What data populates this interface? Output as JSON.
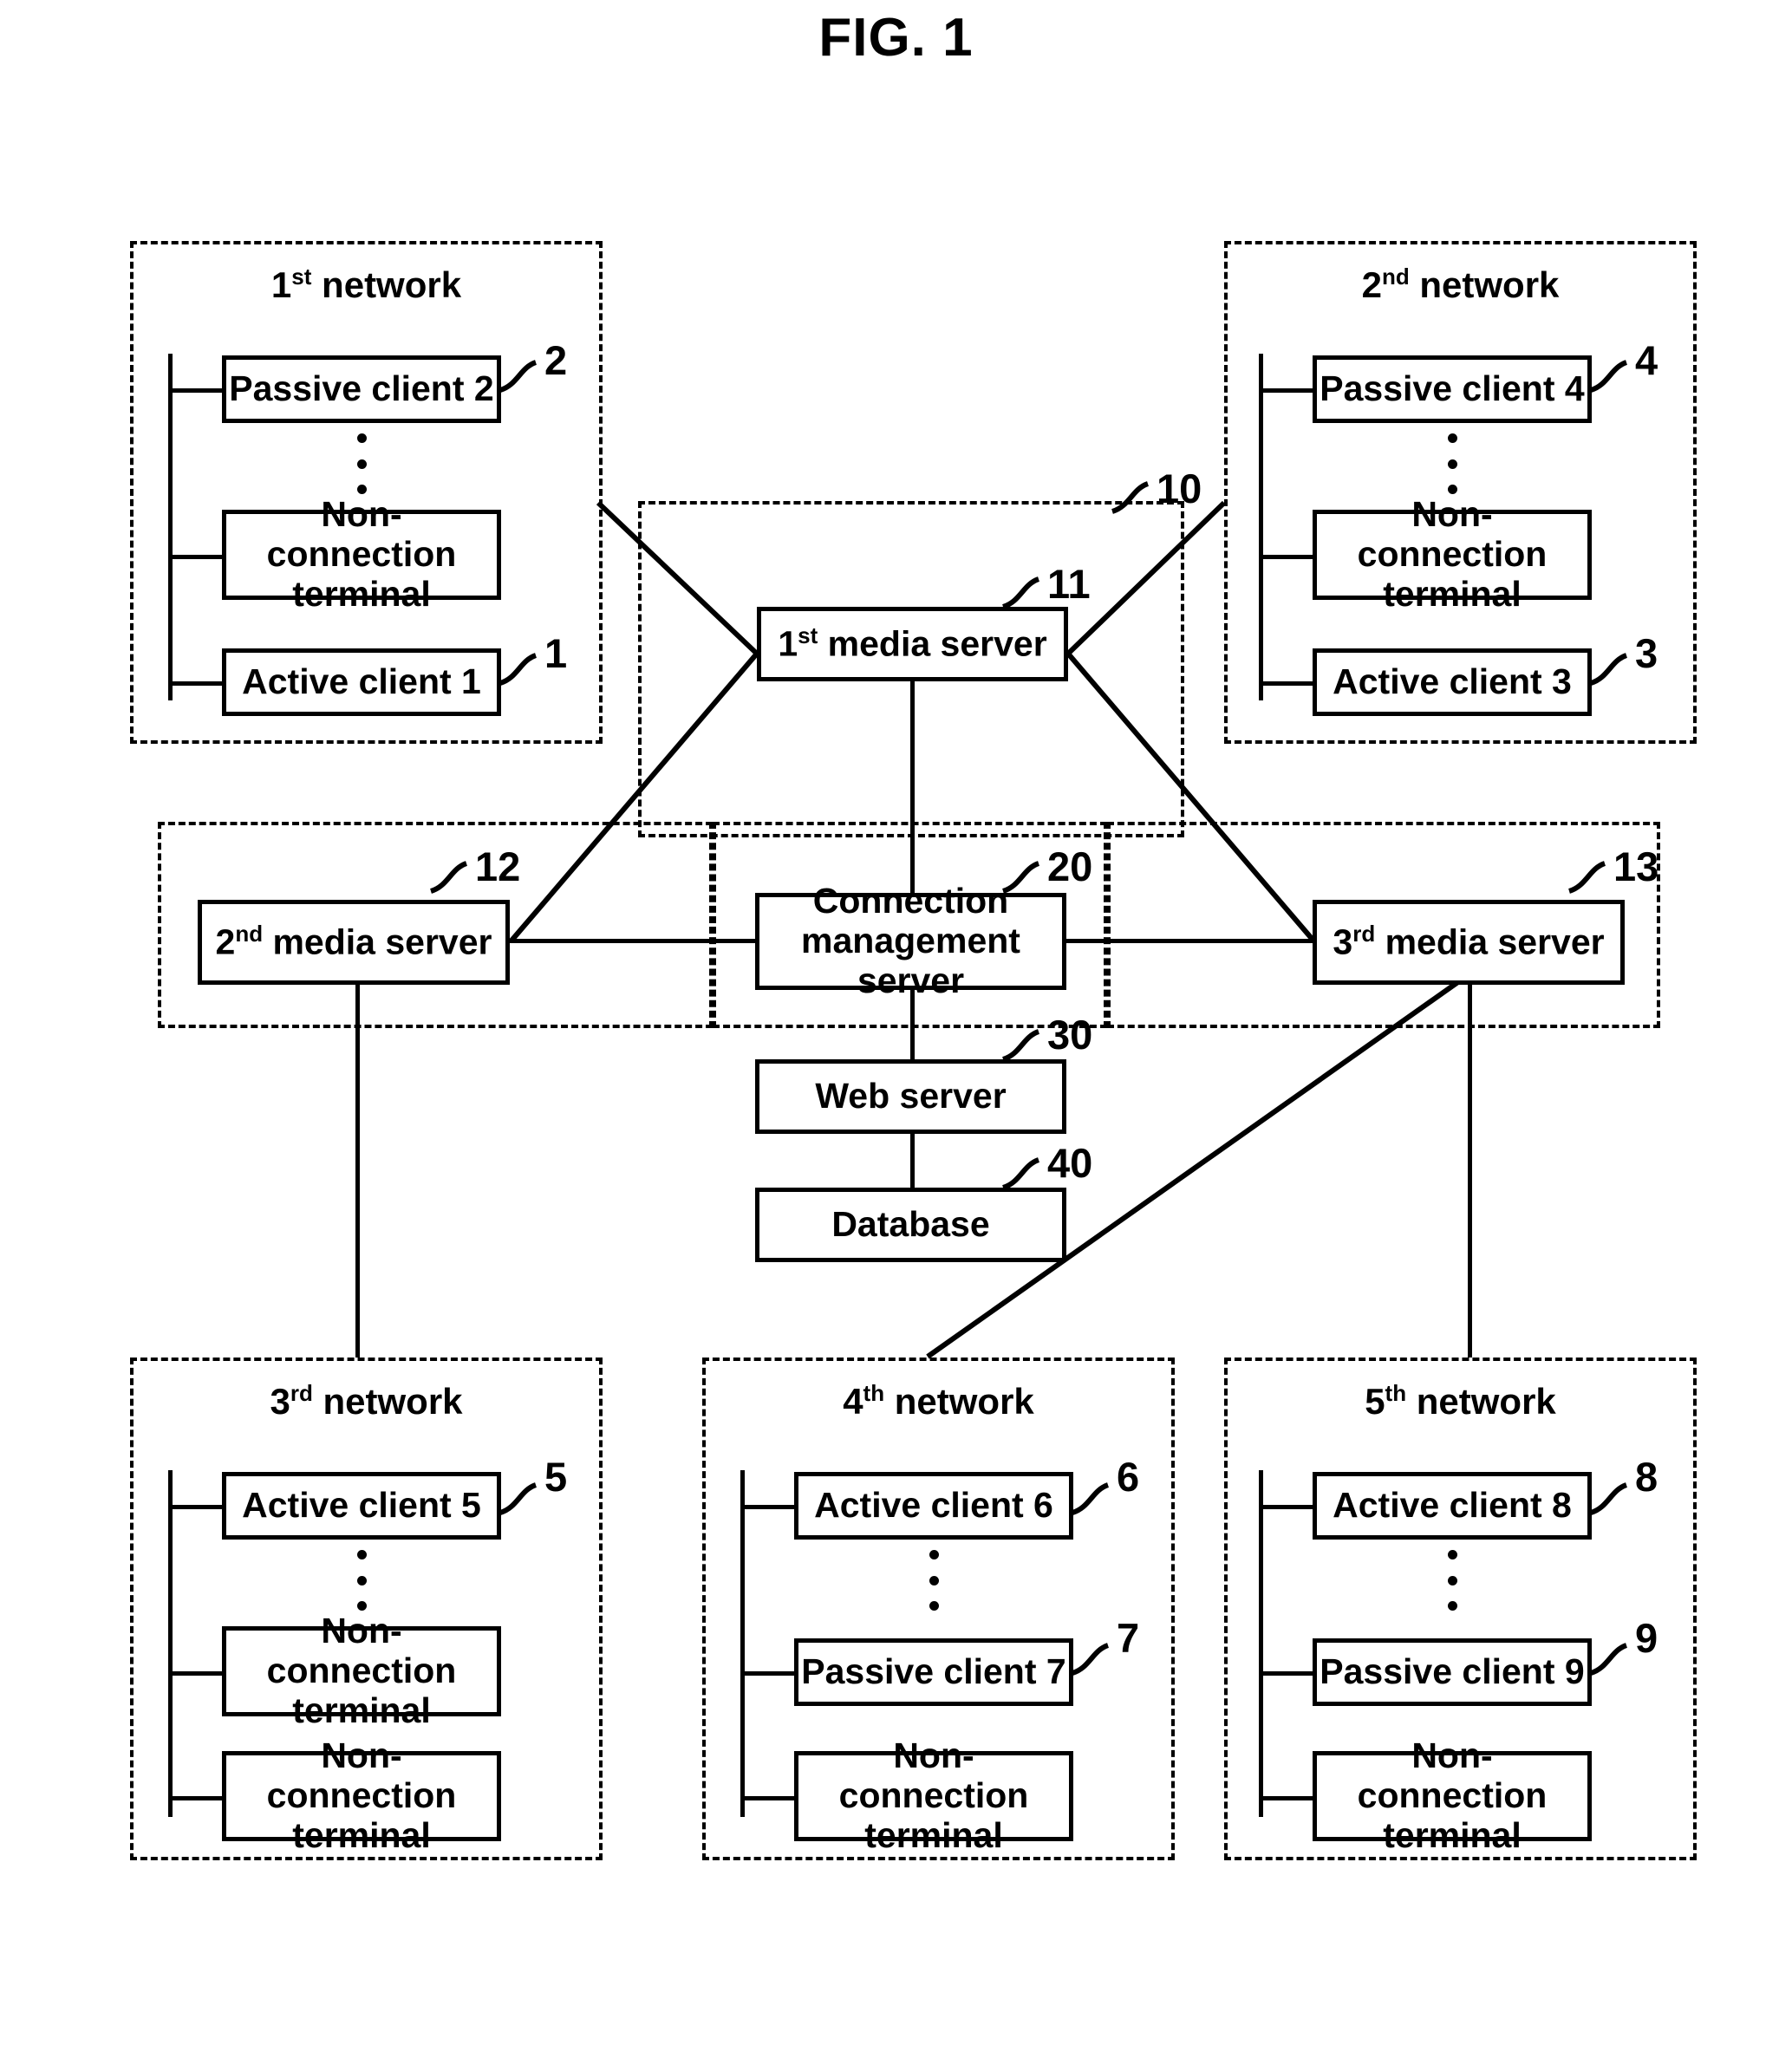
{
  "figure": {
    "title": "FIG. 1"
  },
  "networks": {
    "n1": {
      "label_num": "1",
      "label_sup": "st",
      "label_tail": " network",
      "nodes": [
        {
          "text": "Passive client 2",
          "ref": "2"
        },
        {
          "text": "Non-connection terminal",
          "ref": ""
        },
        {
          "text": "Active client 1",
          "ref": "1"
        }
      ]
    },
    "n2": {
      "label_num": "2",
      "label_sup": "nd",
      "label_tail": " network",
      "nodes": [
        {
          "text": "Passive client 4",
          "ref": "4"
        },
        {
          "text": "Non-connection terminal",
          "ref": ""
        },
        {
          "text": "Active client 3",
          "ref": "3"
        }
      ]
    },
    "n3": {
      "label_num": "3",
      "label_sup": "rd",
      "label_tail": " network",
      "nodes": [
        {
          "text": "Active client 5",
          "ref": "5"
        },
        {
          "text": "Non-connection terminal",
          "ref": ""
        },
        {
          "text": "Non-connection terminal",
          "ref": ""
        }
      ]
    },
    "n4": {
      "label_num": "4",
      "label_sup": "th",
      "label_tail": " network",
      "nodes": [
        {
          "text": "Active client 6",
          "ref": "6"
        },
        {
          "text": "Passive client 7",
          "ref": "7"
        },
        {
          "text": "Non-connection terminal",
          "ref": ""
        }
      ]
    },
    "n5": {
      "label_num": "5",
      "label_sup": "th",
      "label_tail": " network",
      "nodes": [
        {
          "text": "Active client 8",
          "ref": "8"
        },
        {
          "text": "Passive client 9",
          "ref": "9"
        },
        {
          "text": "Non-connection terminal",
          "ref": ""
        }
      ]
    }
  },
  "servers": {
    "media1": {
      "num": "1",
      "sup": "st",
      "tail": " media server",
      "ref": "11"
    },
    "media2": {
      "num": "2",
      "sup": "nd",
      "tail": " media server",
      "ref": "12"
    },
    "media3": {
      "num": "3",
      "sup": "rd",
      "tail": " media server",
      "ref": "13"
    },
    "connection_management": {
      "line1": "Connection",
      "line2": "management server",
      "ref": "20"
    },
    "web": {
      "text": "Web server",
      "ref": "30"
    },
    "database": {
      "text": "Database",
      "ref": "40"
    }
  },
  "regions": {
    "media_group": {
      "ref": "10"
    }
  }
}
